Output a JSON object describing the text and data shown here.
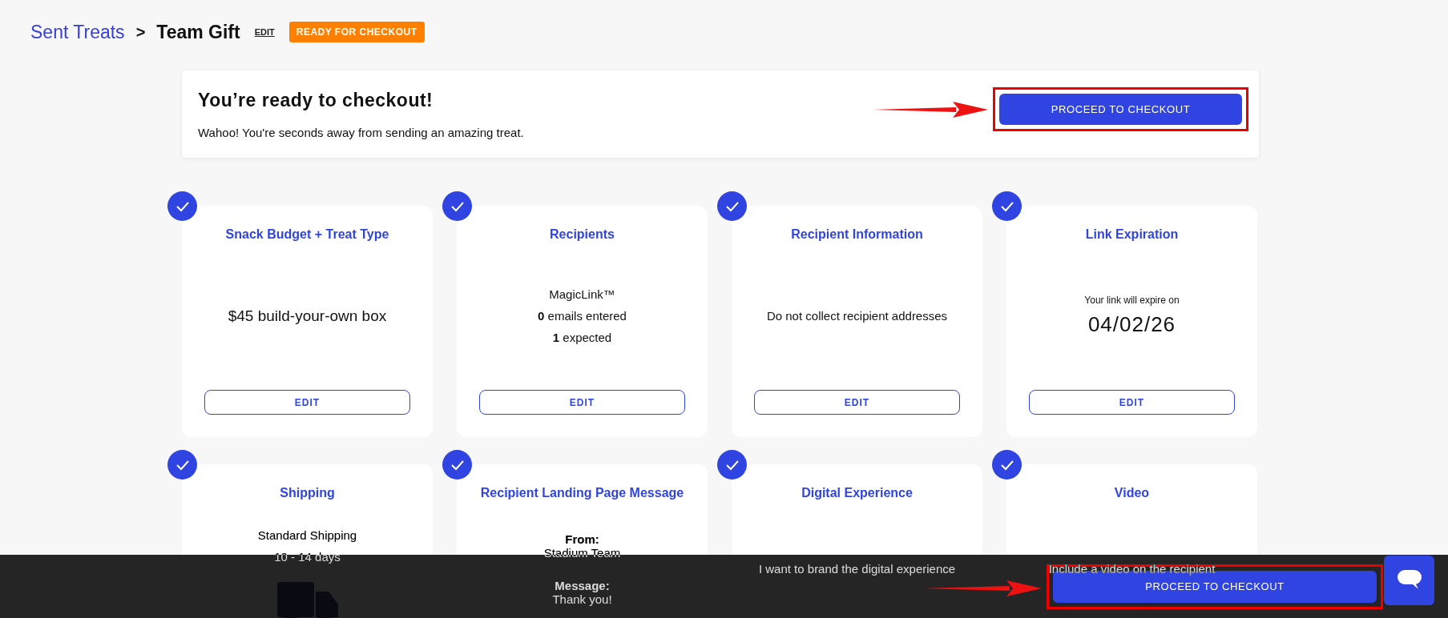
{
  "breadcrumb": {
    "parent": "Sent Treats",
    "separator": ">",
    "current": "Team Gift",
    "edit_link": "EDIT",
    "status_badge": "READY FOR CHECKOUT"
  },
  "checkout_banner": {
    "title": "You’re ready to checkout!",
    "message": "Wahoo! You're seconds away from sending an amazing treat.",
    "button": "PROCEED TO CHECKOUT"
  },
  "steps": [
    {
      "title": "Snack Budget + Treat Type",
      "completed": true,
      "kind": "big",
      "lines": [
        "$45 build-your-own box"
      ],
      "edit_button": "EDIT"
    },
    {
      "title": "Recipients",
      "completed": true,
      "kind": "lines",
      "lines": [
        "MagicLink™",
        "**0** emails entered",
        "**1** expected"
      ],
      "edit_button": "EDIT"
    },
    {
      "title": "Recipient Information",
      "completed": true,
      "kind": "lines",
      "lines": [
        "Do not collect recipient addresses"
      ],
      "edit_button": "EDIT"
    },
    {
      "title": "Link Expiration",
      "completed": true,
      "kind": "date",
      "caption": "Your link will expire on",
      "date": "04/02/26",
      "edit_button": "EDIT"
    },
    {
      "title": "Shipping",
      "completed": true,
      "kind": "shipping",
      "lines": [
        "Standard Shipping",
        "10 - 14 days"
      ]
    },
    {
      "title": "Recipient Landing Page Message",
      "completed": true,
      "kind": "message",
      "sections": [
        {
          "label": "From:",
          "text": "Stadium Team"
        },
        {
          "label": "Message:",
          "text": "Thank you!"
        }
      ]
    },
    {
      "title": "Digital Experience",
      "completed": true,
      "kind": "note",
      "lines": [
        "I want to brand the digital experience"
      ]
    },
    {
      "title": "Video",
      "completed": true,
      "kind": "note",
      "lines": [
        "Include a video on the recipient"
      ]
    }
  ],
  "footer_bar": {
    "button": "PROCEED TO CHECKOUT"
  }
}
